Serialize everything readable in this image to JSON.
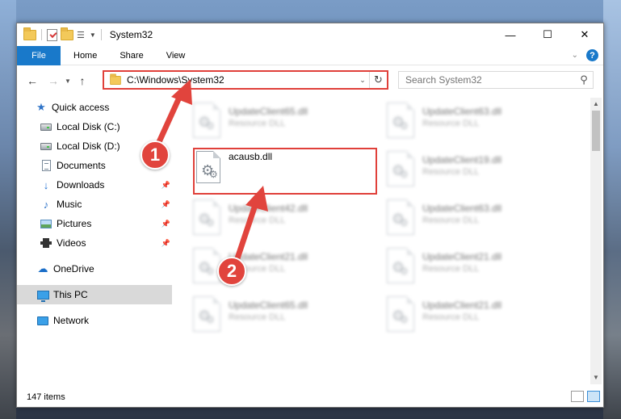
{
  "window": {
    "title": "System32",
    "controls": {
      "minimize": "—",
      "maximize": "☐",
      "close": "✕"
    }
  },
  "ribbon": {
    "tabs": [
      {
        "label": "File"
      },
      {
        "label": "Home"
      },
      {
        "label": "Share"
      },
      {
        "label": "View"
      }
    ],
    "help": "?"
  },
  "address": {
    "path": "C:\\Windows\\System32",
    "search_placeholder": "Search System32"
  },
  "sidebar": {
    "quick_access": "Quick access",
    "items": [
      {
        "label": "Local Disk (C:)"
      },
      {
        "label": "Local Disk (D:)"
      },
      {
        "label": "Documents"
      },
      {
        "label": "Downloads"
      },
      {
        "label": "Music"
      },
      {
        "label": "Pictures"
      },
      {
        "label": "Videos"
      }
    ],
    "onedrive": "OneDrive",
    "this_pc": "This PC",
    "network": "Network"
  },
  "files": {
    "highlighted": {
      "name": "acausb.dll",
      "type": ""
    },
    "blurred": [
      {
        "name": "UpdateClient65.dll",
        "type": "Resource DLL"
      },
      {
        "name": "UpdateClient63.dll",
        "type": "Resource DLL"
      },
      {
        "name": "UpdateClient19.dll",
        "type": "Resource DLL"
      },
      {
        "name": "UpdateClient42.dll",
        "type": "Resource DLL"
      },
      {
        "name": "UpdateClient63.dll",
        "type": "Resource DLL"
      },
      {
        "name": "UpdateClient21.dll",
        "type": "Resource DLL"
      },
      {
        "name": "UpdateClient21.dll",
        "type": "Resource DLL"
      },
      {
        "name": "UpdateClient65.dll",
        "type": "Resource DLL"
      },
      {
        "name": "UpdateClient21.dll",
        "type": "Resource DLL"
      }
    ]
  },
  "status": {
    "item_count": "147 items"
  },
  "annotations": {
    "step1": "1",
    "step2": "2"
  },
  "colors": {
    "accent": "#1979ca",
    "highlight": "#e0403a",
    "selected": "#d9d9d9"
  }
}
